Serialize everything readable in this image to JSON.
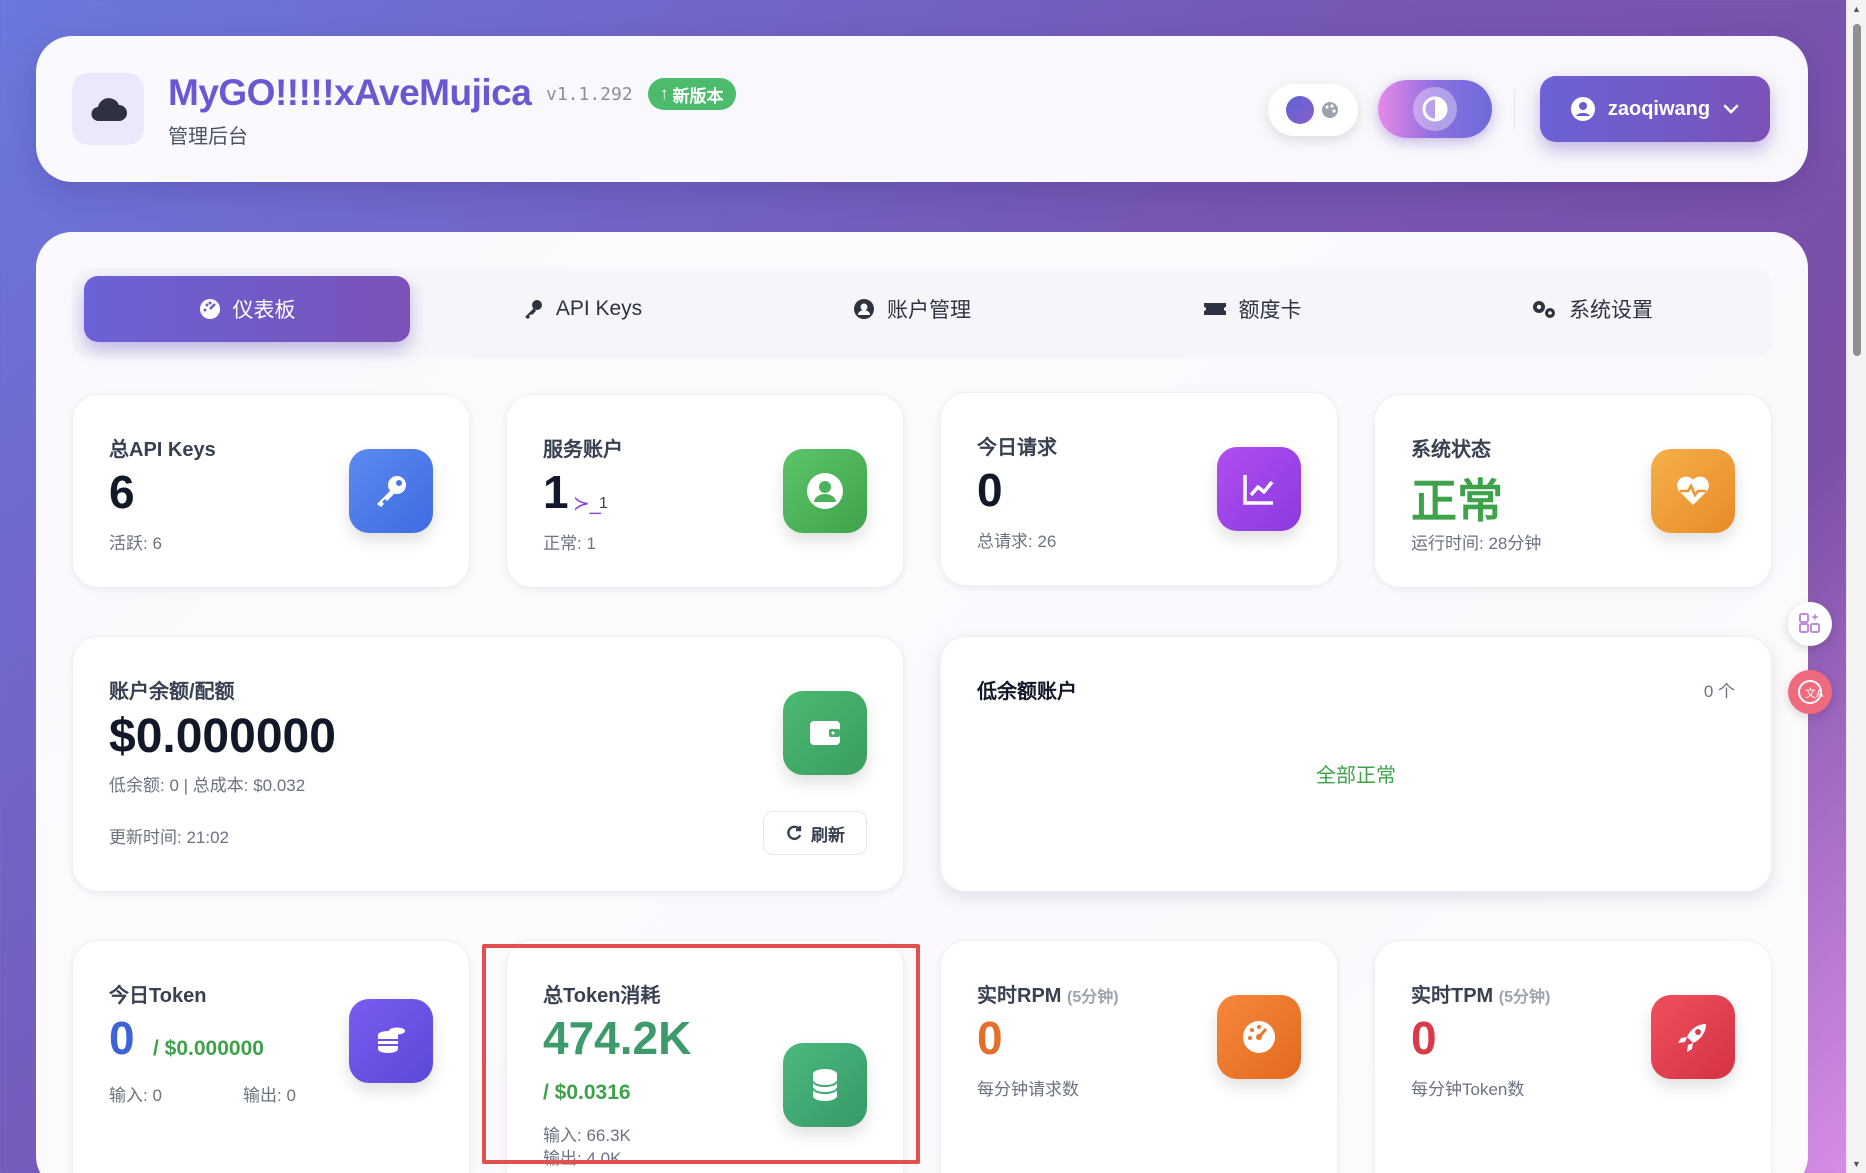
{
  "header": {
    "app_title": "MyGO!!!!!xAveMujica",
    "version": "v1.1.292",
    "new_badge": "新版本",
    "subtitle": "管理后台",
    "username": "zaoqiwang"
  },
  "tabs": [
    {
      "label": "仪表板",
      "icon": "dashboard-icon",
      "active": true
    },
    {
      "label": "API Keys",
      "icon": "key-icon",
      "active": false
    },
    {
      "label": "账户管理",
      "icon": "user-circle-icon",
      "active": false
    },
    {
      "label": "额度卡",
      "icon": "ticket-icon",
      "active": false
    },
    {
      "label": "系统设置",
      "icon": "gears-icon",
      "active": false
    }
  ],
  "stats": {
    "api_keys": {
      "label": "总API Keys",
      "value": "6",
      "sub": "活跃: 6",
      "color": "#4f7ce8"
    },
    "service_accounts": {
      "label": "服务账户",
      "value": "1",
      "extra_symbol": "≻_",
      "extra_count": "1",
      "sub": "正常: 1",
      "color": "#4cb85c"
    },
    "today_requests": {
      "label": "今日请求",
      "value": "0",
      "sub": "总请求: 26",
      "color": "#9b48e6"
    },
    "system_status": {
      "label": "系统状态",
      "value": "正常",
      "sub": "运行时间: 28分钟",
      "color": "#f0a23a"
    }
  },
  "balance": {
    "label": "账户余额/配额",
    "value": "$0.000000",
    "sub": "低余额: 0 | 总成本: $0.032",
    "updated": "更新时间: 21:02",
    "refresh_label": "刷新"
  },
  "low_balance": {
    "title": "低余额账户",
    "count": "0 个",
    "status": "全部正常"
  },
  "tokens": {
    "today": {
      "label": "今日Token",
      "value": "0",
      "cost": "/ $0.000000",
      "input": "输入: 0",
      "output": "输出: 0"
    },
    "total": {
      "label": "总Token消耗",
      "value": "474.2K",
      "cost": "/ $0.0316",
      "input": "输入: 66.3K",
      "output": "输出: 4.0K"
    },
    "rpm": {
      "label": "实时RPM",
      "window": "(5分钟)",
      "value": "0",
      "sub": "每分钟请求数"
    },
    "tpm": {
      "label": "实时TPM",
      "window": "(5分钟)",
      "value": "0",
      "sub": "每分钟Token数"
    }
  },
  "colors": {
    "accent": "#6a58d2",
    "success": "#3ea24a",
    "highlight_box": "#e34f4f"
  }
}
